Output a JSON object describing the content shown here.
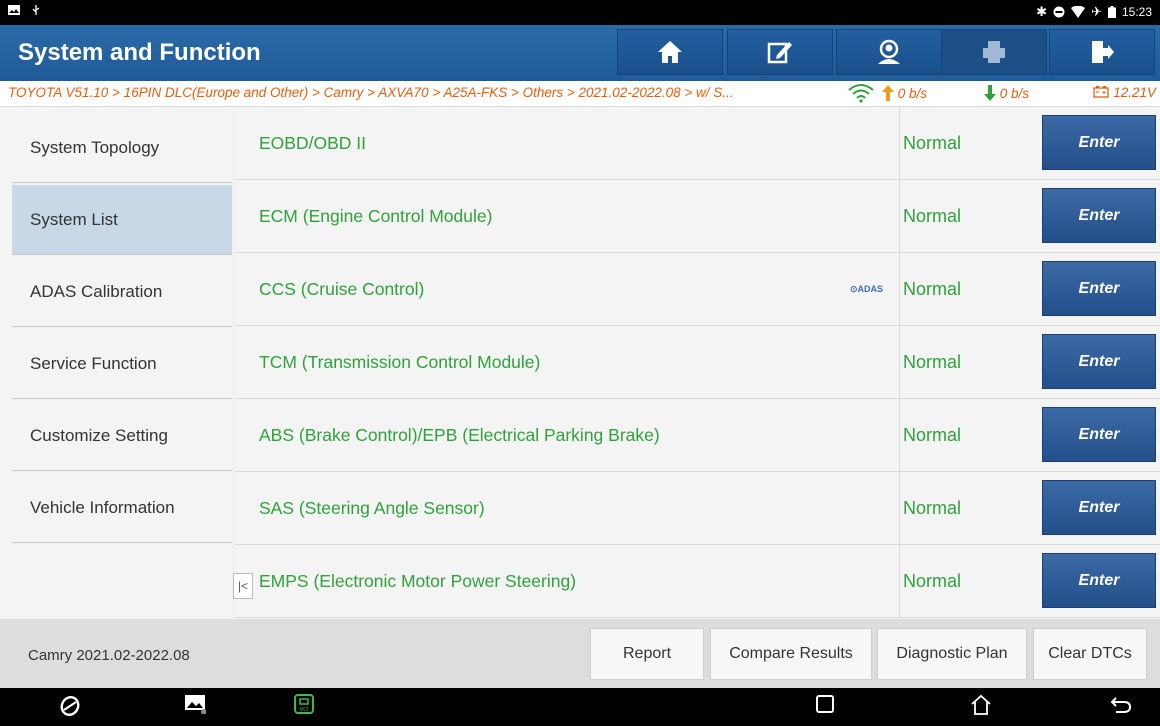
{
  "statusbar": {
    "time": "15:23"
  },
  "header": {
    "title": "System and Function",
    "buttons": [
      "home-icon",
      "edit-icon",
      "person-icon",
      "print-icon",
      "exit-icon"
    ]
  },
  "breadcrumb": {
    "path": "TOYOTA V51.10 > 16PIN DLC(Europe and Other) > Camry > AXVA70 > A25A-FKS > Others > 2021.02-2022.08 > w/ S...",
    "upload": "0 b/s",
    "download": "0 b/s",
    "voltage": "12.21V"
  },
  "sidebar": {
    "items": [
      {
        "label": "System Topology"
      },
      {
        "label": "System List"
      },
      {
        "label": "ADAS Calibration"
      },
      {
        "label": "Service Function"
      },
      {
        "label": "Customize Setting"
      },
      {
        "label": "Vehicle Information"
      }
    ],
    "active_index": 1
  },
  "systems": {
    "enter_label": "Enter",
    "adas_badge": "⊙ADAS",
    "rows": [
      {
        "name": "EOBD/OBD II",
        "status": "Normal"
      },
      {
        "name": "ECM (Engine Control Module)",
        "status": "Normal"
      },
      {
        "name": "CCS (Cruise Control)",
        "status": "Normal"
      },
      {
        "name": "TCM (Transmission Control Module)",
        "status": "Normal"
      },
      {
        "name": "ABS (Brake Control)/EPB (Electrical Parking Brake)",
        "status": "Normal"
      },
      {
        "name": "SAS (Steering Angle Sensor)",
        "status": "Normal"
      },
      {
        "name": "EMPS (Electronic Motor Power Steering)",
        "status": "Normal"
      }
    ]
  },
  "footer": {
    "vehicle": "Camry 2021.02-2022.08",
    "buttons": {
      "report": "Report",
      "compare": "Compare Results",
      "plan": "Diagnostic Plan",
      "clear": "Clear DTCs"
    }
  },
  "colors": {
    "header": "#1f5b98",
    "status_green": "#2fa23a",
    "breadcrumb_orange": "#e85d0c",
    "enter_button": "#2a5893",
    "active_tab": "#c9d8e6"
  }
}
